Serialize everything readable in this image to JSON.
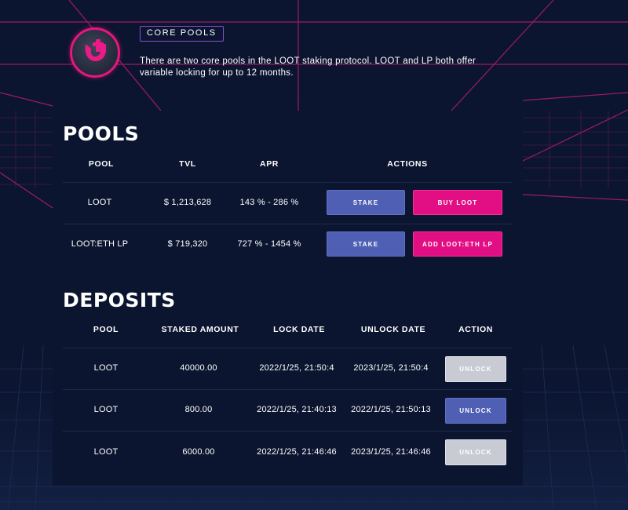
{
  "header": {
    "badge": "CORE POOLS",
    "description": "There are two core pools in the LOOT staking protocol. LOOT and LP both offer variable locking for up to 12 months."
  },
  "pools": {
    "title": "POOLS",
    "columns": [
      "POOL",
      "TVL",
      "APR",
      "ACTIONS"
    ],
    "rows": [
      {
        "pool": "LOOT",
        "tvl": "$ 1,213,628",
        "apr": "143 % - 286 %",
        "stake_label": "STAKE",
        "secondary_label": "BUY LOOT"
      },
      {
        "pool": "LOOT:ETH LP",
        "tvl": "$ 719,320",
        "apr": "727 % - 1454 %",
        "stake_label": "STAKE",
        "secondary_label": "ADD LOOT:ETH LP"
      }
    ]
  },
  "deposits": {
    "title": "DEPOSITS",
    "columns": [
      "POOL",
      "STAKED AMOUNT",
      "LOCK DATE",
      "UNLOCK DATE",
      "ACTION"
    ],
    "rows": [
      {
        "pool": "LOOT",
        "amount": "40000.00",
        "lock_date": "2022/1/25, 21:50:4",
        "unlock_date": "2023/1/25, 21:50:4",
        "action_label": "UNLOCK",
        "action_state": "disabled"
      },
      {
        "pool": "LOOT",
        "amount": "800.00",
        "lock_date": "2022/1/25, 21:40:13",
        "unlock_date": "2022/1/25, 21:50:13",
        "action_label": "UNLOCK",
        "action_state": "enabled"
      },
      {
        "pool": "LOOT",
        "amount": "6000.00",
        "lock_date": "2022/1/25, 21:46:46",
        "unlock_date": "2023/1/25, 21:46:46",
        "action_label": "UNLOCK",
        "action_state": "disabled"
      }
    ]
  },
  "colors": {
    "background": "#0b1530",
    "grid_line": "#c0206f",
    "accent_pink": "#e20e83",
    "button_blue": "#4f5fb3",
    "button_disabled": "#c8cbd4"
  }
}
